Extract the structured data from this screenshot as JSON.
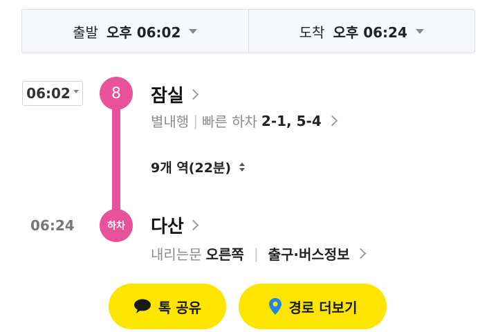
{
  "time_bar": {
    "departure_label": "출발",
    "departure_value": "오후 06:02",
    "arrival_label": "도착",
    "arrival_value": "오후 06:24"
  },
  "route": {
    "line_badge": "8",
    "departure_time": "06:02",
    "departure_station": "잠실",
    "direction": "별내행",
    "fast_exit_label": "빠른 하차",
    "fast_exit_doors": "2-1, 5-4",
    "stops_summary": "9개 역(22분)",
    "arrival_time": "06:24",
    "alight_badge": "하차",
    "arrival_station": "다산",
    "door_label": "내리는문",
    "door_side": "오른쪽",
    "exit_info_label": "출구·버스정보"
  },
  "actions": {
    "share_label": "톡 공유",
    "more_label": "경로 더보기"
  },
  "colors": {
    "line_8": "#e9519a",
    "kakao_yellow": "#fee500",
    "pin_blue": "#1f86e8"
  }
}
